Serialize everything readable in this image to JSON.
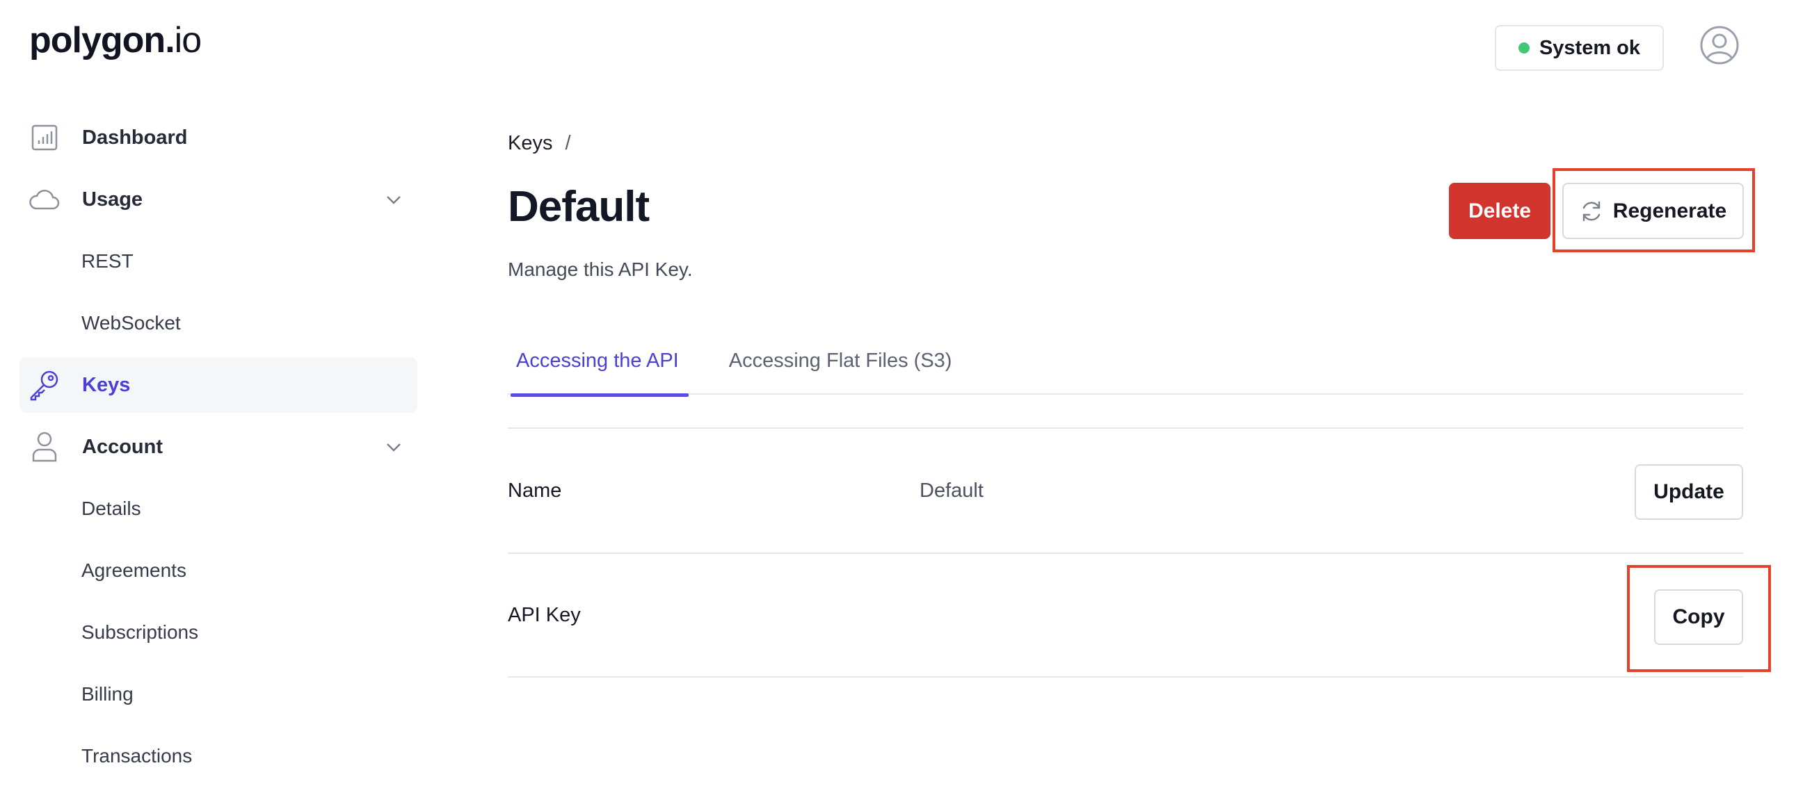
{
  "brand": {
    "name": "polygon",
    "dot": ".",
    "suffix": "io"
  },
  "header": {
    "status_label": "System ok",
    "status_color": "#41c873",
    "avatar_icon": "user-circle-icon"
  },
  "sidebar": {
    "items": [
      {
        "label": "Dashboard",
        "icon": "bar-chart-icon"
      },
      {
        "label": "Usage",
        "icon": "cloud-icon",
        "expandable": true,
        "children": [
          "REST",
          "WebSocket"
        ]
      },
      {
        "label": "Keys",
        "icon": "key-icon",
        "active": true
      },
      {
        "label": "Account",
        "icon": "user-icon",
        "expandable": true,
        "children": [
          "Details",
          "Agreements",
          "Subscriptions",
          "Billing",
          "Transactions"
        ]
      }
    ]
  },
  "main": {
    "breadcrumb": {
      "parent": "Keys",
      "separator": "/"
    },
    "title": "Default",
    "subtitle": "Manage this API Key.",
    "actions": {
      "delete_label": "Delete",
      "regenerate_label": "Regenerate"
    },
    "tabs": [
      {
        "label": "Accessing the API",
        "active": true
      },
      {
        "label": "Accessing Flat Files (S3)",
        "active": false
      }
    ],
    "rows": [
      {
        "label": "Name",
        "value": "Default",
        "button": "Update"
      },
      {
        "label": "API Key",
        "value": "",
        "button": "Copy"
      }
    ]
  },
  "colors": {
    "accent": "#4b3fd6",
    "danger": "#d2352e",
    "highlight": "#e4402a"
  }
}
